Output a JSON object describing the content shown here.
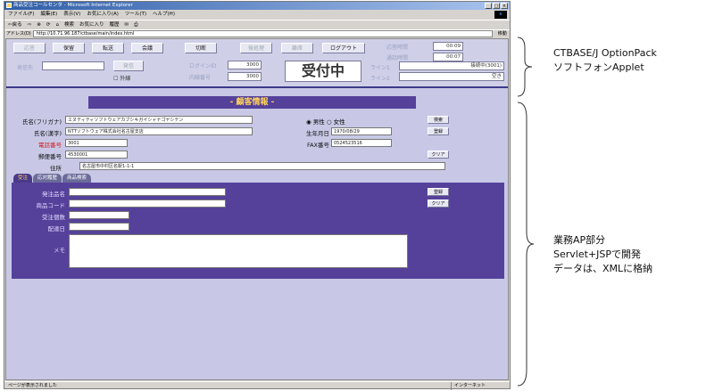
{
  "window": {
    "title": "商品受注コールセンタ - Microsoft Internet Explorer"
  },
  "menu": [
    "ファイル(F)",
    "編集(E)",
    "表示(V)",
    "お気に入り(A)",
    "ツール(T)",
    "ヘルプ(H)"
  ],
  "toolbar": [
    "⇦戻る",
    "⇨",
    "⊗",
    "⟳",
    "⌂",
    "検索",
    "お気に入り",
    "履歴",
    "✉",
    "⎙"
  ],
  "address": {
    "label": "アドレス(D)",
    "url": "http://10.71.96.187/ctbase/main/index.html",
    "go": "移動"
  },
  "applet": {
    "buttons": [
      "応答",
      "保留",
      "転送",
      "会議",
      "切断",
      "後処理",
      "離席",
      "ログアウト"
    ],
    "labels": {
      "answer_time": "応答時間",
      "call_time": "通話時間",
      "dial": "発信先",
      "dial_btn": "発信",
      "external": "外線",
      "login_id": "ログインID",
      "extension": "内線番号",
      "line1": "ライン1",
      "line2": "ライン2"
    },
    "values": {
      "answer_time": "00:09",
      "call_time": "00:07",
      "login_id": "3000",
      "extension": "3000",
      "status": "受付中",
      "line1": "接続中(3001)",
      "line2": "空き"
    }
  },
  "form": {
    "header": "- 顧客情報 -",
    "labels": {
      "name_kana": "氏名(フリガナ)",
      "name_kanji": "氏名(漢字)",
      "phone": "電話番号",
      "zip": "郵便番号",
      "address": "住所",
      "gender_m": "男性",
      "gender_f": "女性",
      "birth": "生年月日",
      "fax": "FAX番号"
    },
    "values": {
      "name_kana": "エヌティティソフトウェアカブシキガイシャナゴヤシテン",
      "name_kanji": "NTTソフトウェア株式会社名古屋支店",
      "phone": "3001",
      "zip": "4530001",
      "address": "名古屋市中村区名駅1-1-1",
      "birth": "1970/08/29",
      "fax": "0524523516"
    },
    "buttons": {
      "search": "検索",
      "register": "登録",
      "clear": "クリア"
    }
  },
  "tabs": [
    "受注",
    "応対履歴",
    "商品検索"
  ],
  "order": {
    "labels": {
      "orderer": "発注品名",
      "code": "商品コード",
      "qty": "受注個数",
      "date": "配達日",
      "memo": "メモ"
    },
    "buttons": {
      "register": "登録",
      "clear": "クリア"
    }
  },
  "status": {
    "text": "ページが表示されました",
    "zone": "インターネット"
  },
  "annotations": {
    "applet_line1": "CTBASE/J OptionPack",
    "applet_line2": "ソフトフォンApplet",
    "ap_line1": "業務AP部分",
    "ap_line2": "Servlet+JSPで開発",
    "ap_line3": "データは、XMLに格納"
  }
}
